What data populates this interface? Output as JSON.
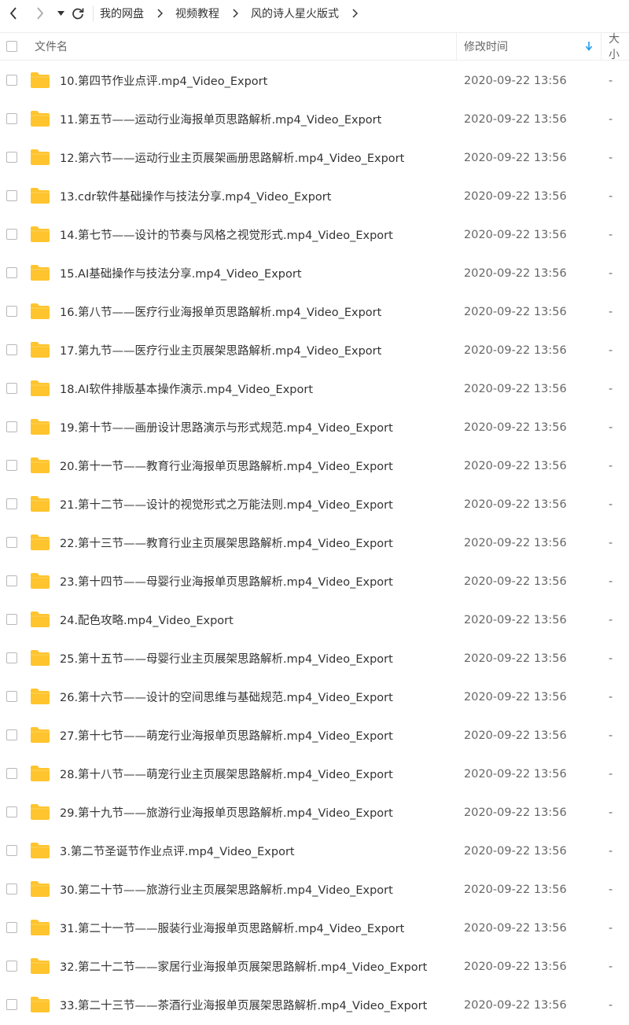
{
  "breadcrumb": [
    "我的网盘",
    "视频教程",
    "风的诗人星火版式"
  ],
  "columns": {
    "name": "文件名",
    "modified": "修改时间",
    "size": "大小"
  },
  "colors": {
    "folder": "#FFC42E",
    "accent": "#1E9BF0",
    "text": "#333333",
    "muted": "#666666"
  },
  "icons": {
    "back": "chevron-left-icon",
    "forward": "chevron-right-icon",
    "dropdown": "caret-down-icon",
    "refresh": "refresh-icon",
    "sort": "arrow-down-icon",
    "folder": "folder-icon"
  },
  "files": [
    {
      "name": "10.第四节作业点评.mp4_Video_Export",
      "modified": "2020-09-22 13:56",
      "size": "-"
    },
    {
      "name": "11.第五节——运动行业海报单页思路解析.mp4_Video_Export",
      "modified": "2020-09-22 13:56",
      "size": "-"
    },
    {
      "name": "12.第六节——运动行业主页展架画册思路解析.mp4_Video_Export",
      "modified": "2020-09-22 13:56",
      "size": "-"
    },
    {
      "name": "13.cdr软件基础操作与技法分享.mp4_Video_Export",
      "modified": "2020-09-22 13:56",
      "size": "-"
    },
    {
      "name": "14.第七节——设计的节奏与风格之视觉形式.mp4_Video_Export",
      "modified": "2020-09-22 13:56",
      "size": "-"
    },
    {
      "name": "15.AI基础操作与技法分享.mp4_Video_Export",
      "modified": "2020-09-22 13:56",
      "size": "-"
    },
    {
      "name": "16.第八节——医疗行业海报单页思路解析.mp4_Video_Export",
      "modified": "2020-09-22 13:56",
      "size": "-"
    },
    {
      "name": "17.第九节——医疗行业主页展架思路解析.mp4_Video_Export",
      "modified": "2020-09-22 13:56",
      "size": "-"
    },
    {
      "name": "18.AI软件排版基本操作演示.mp4_Video_Export",
      "modified": "2020-09-22 13:56",
      "size": "-"
    },
    {
      "name": "19.第十节——画册设计思路演示与形式规范.mp4_Video_Export",
      "modified": "2020-09-22 13:56",
      "size": "-"
    },
    {
      "name": "20.第十一节——教育行业海报单页思路解析.mp4_Video_Export",
      "modified": "2020-09-22 13:56",
      "size": "-"
    },
    {
      "name": "21.第十二节——设计的视觉形式之万能法则.mp4_Video_Export",
      "modified": "2020-09-22 13:56",
      "size": "-"
    },
    {
      "name": "22.第十三节——教育行业主页展架思路解析.mp4_Video_Export",
      "modified": "2020-09-22 13:56",
      "size": "-"
    },
    {
      "name": "23.第十四节——母婴行业海报单页思路解析.mp4_Video_Export",
      "modified": "2020-09-22 13:56",
      "size": "-"
    },
    {
      "name": "24.配色攻略.mp4_Video_Export",
      "modified": "2020-09-22 13:56",
      "size": "-"
    },
    {
      "name": "25.第十五节——母婴行业主页展架思路解析.mp4_Video_Export",
      "modified": "2020-09-22 13:56",
      "size": "-"
    },
    {
      "name": "26.第十六节——设计的空间思维与基础规范.mp4_Video_Export",
      "modified": "2020-09-22 13:56",
      "size": "-"
    },
    {
      "name": "27.第十七节——萌宠行业海报单页思路解析.mp4_Video_Export",
      "modified": "2020-09-22 13:56",
      "size": "-"
    },
    {
      "name": "28.第十八节——萌宠行业主页展架思路解析.mp4_Video_Export",
      "modified": "2020-09-22 13:56",
      "size": "-"
    },
    {
      "name": "29.第十九节——旅游行业海报单页思路解析.mp4_Video_Export",
      "modified": "2020-09-22 13:56",
      "size": "-"
    },
    {
      "name": "3.第二节圣诞节作业点评.mp4_Video_Export",
      "modified": "2020-09-22 13:56",
      "size": "-"
    },
    {
      "name": "30.第二十节——旅游行业主页展架思路解析.mp4_Video_Export",
      "modified": "2020-09-22 13:56",
      "size": "-"
    },
    {
      "name": "31.第二十一节——服装行业海报单页思路解析.mp4_Video_Export",
      "modified": "2020-09-22 13:56",
      "size": "-"
    },
    {
      "name": "32.第二十二节——家居行业海报单页展架思路解析.mp4_Video_Export",
      "modified": "2020-09-22 13:56",
      "size": "-"
    },
    {
      "name": "33.第二十三节——茶酒行业海报单页展架思路解析.mp4_Video_Export",
      "modified": "2020-09-22 13:56",
      "size": "-"
    }
  ]
}
